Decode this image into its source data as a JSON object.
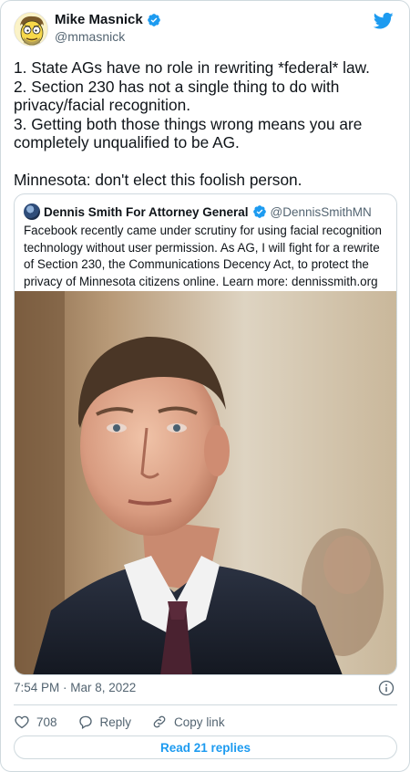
{
  "tweet": {
    "author_name": "Mike Masnick",
    "author_handle": "@mmasnick",
    "text": "1. State AGs have no role in rewriting *federal* law.\n2. Section 230 has not a single thing to do with privacy/facial recognition.\n3. Getting both those things wrong means you are completely unqualified to be AG.\n\nMinnesota: don't elect this foolish person.",
    "timestamp": "7:54 PM · Mar 8, 2022"
  },
  "quoted_tweet": {
    "author_name": "Dennis Smith For Attorney General",
    "author_handle": "@DennisSmithMN",
    "text": "Facebook recently came under scrutiny for using facial recognition technology without user permission. As AG, I will fight for a rewrite of Section 230, the Communications Decency Act, to protect the privacy of Minnesota citizens online. Learn more: dennissmith.org"
  },
  "actions": {
    "like_count": "708",
    "reply_label": "Reply",
    "copy_link_label": "Copy link",
    "read_replies_label": "Read 21 replies"
  },
  "icons": {
    "brand": "twitter-bird-icon",
    "verified": "verified-badge-icon",
    "info": "info-icon",
    "like": "heart-icon",
    "reply": "speech-bubble-icon",
    "copy_link": "link-icon"
  },
  "colors": {
    "brand_blue": "#1d9bf0",
    "text_primary": "#0f1419",
    "text_secondary": "#536471",
    "border": "#cfd9de"
  }
}
